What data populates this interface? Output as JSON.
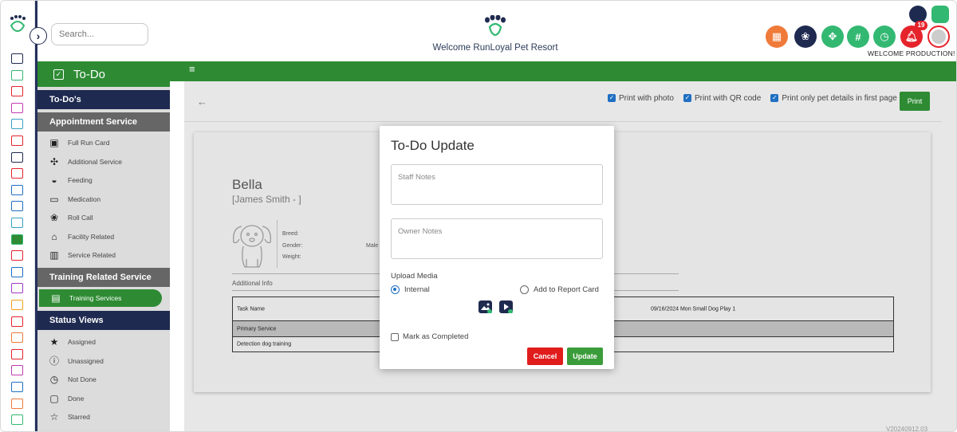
{
  "header": {
    "search_placeholder": "Search...",
    "welcome_title": "Welcome RunLoyal Pet Resort",
    "welcome_user": "WELCOME PRODUCTION!",
    "notification_count": "19",
    "colors": {
      "navy": "#1f2a50",
      "green": "#2e8b33",
      "orange": "#f07a3a",
      "teal": "#33b872",
      "red": "#e6232b"
    }
  },
  "rail_icons": [
    "home-icon",
    "monitor-icon",
    "calendar-icon",
    "dog-walk-icon",
    "group-icon",
    "store-icon",
    "today-icon",
    "alert-icon",
    "calendar-icon",
    "schedule-icon",
    "grid-icon",
    "todo-icon",
    "report-icon",
    "cart-icon",
    "award-icon",
    "paw-icon",
    "check-icon",
    "user-icon",
    "chat-icon",
    "image-icon",
    "thumbs-up-icon",
    "rocket-icon",
    "chart-icon",
    "settings-icon"
  ],
  "sidebar": {
    "title": "To-Do",
    "sections": [
      {
        "label": "To-Do's"
      },
      {
        "label": "Appointment Service"
      },
      {
        "label": "Training Related Service"
      },
      {
        "label": "Status Views"
      }
    ],
    "appointment_items": [
      {
        "label": "Full Run Card",
        "icon": "card-icon"
      },
      {
        "label": "Additional Service",
        "icon": "puzzle-icon"
      },
      {
        "label": "Feeding",
        "icon": "bowl-icon"
      },
      {
        "label": "Medication",
        "icon": "medicine-icon"
      },
      {
        "label": "Roll Call",
        "icon": "paw-icon"
      },
      {
        "label": "Facility Related",
        "icon": "building-icon"
      },
      {
        "label": "Service Related",
        "icon": "barcode-icon"
      }
    ],
    "training_items": [
      {
        "label": "Training Services",
        "icon": "list-icon"
      }
    ],
    "status_items": [
      {
        "label": "Assigned",
        "icon": "star-icon"
      },
      {
        "label": "Unassigned",
        "icon": "info-icon"
      },
      {
        "label": "Not Done",
        "icon": "clock-icon"
      },
      {
        "label": "Done",
        "icon": "calendar-icon"
      },
      {
        "label": "Starred",
        "icon": "star-outline-icon"
      }
    ]
  },
  "toolbar": {
    "print_with_photo": "Print with photo",
    "print_with_qr": "Print with QR code",
    "print_only_first": "Print only pet details in first page",
    "print_button": "Print"
  },
  "card": {
    "pet_name": "Bella",
    "owner": "[James Smith - ]",
    "breed_label": "Breed:",
    "gender_label": "Gender:",
    "gender_value": "Male",
    "weight_label": "Weight:",
    "additional_info": "Additional Info",
    "task_header": "Task Name",
    "task_date": "09/16/2024 Mon Small Dog Play 1",
    "primary_service": "Primary Service",
    "task_row": "Detection dog training"
  },
  "version": "V20240912.03",
  "modal": {
    "title": "To-Do Update",
    "staff_notes_placeholder": "Staff Notes",
    "owner_notes_placeholder": "Owner Notes",
    "upload_media": "Upload Media",
    "internal": "Internal",
    "add_to_report": "Add to Report Card",
    "mark_completed": "Mark as Completed",
    "cancel": "Cancel",
    "update": "Update"
  }
}
